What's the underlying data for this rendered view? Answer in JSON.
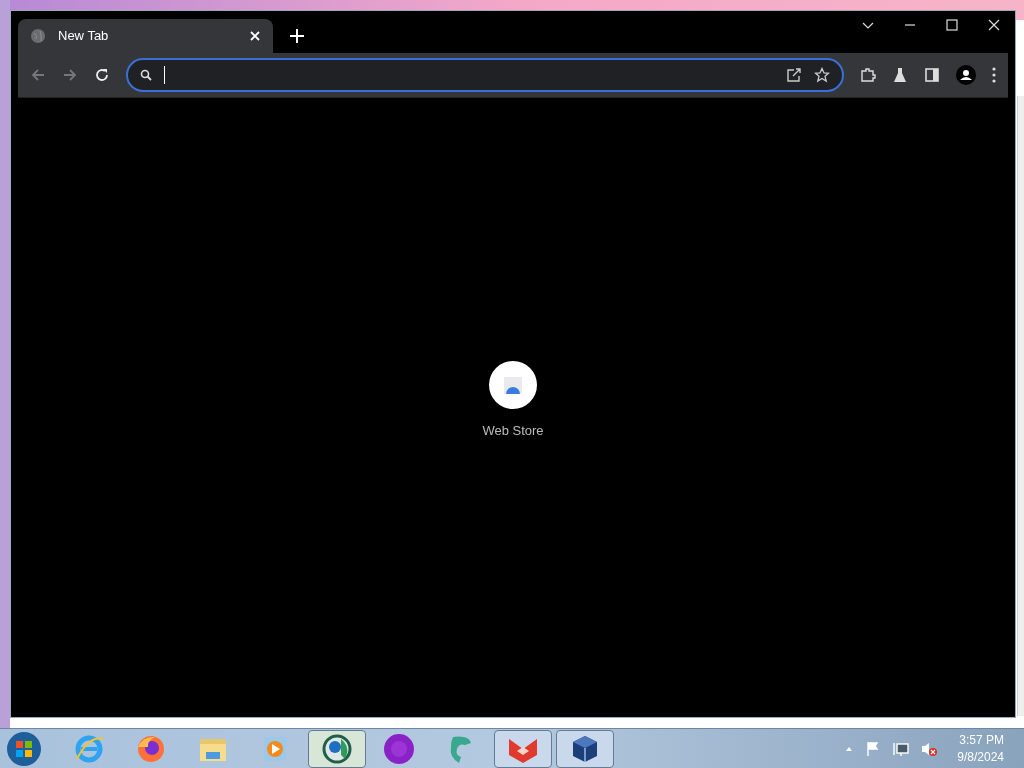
{
  "browser": {
    "tabs": [
      {
        "title": "New Tab",
        "selected": true
      }
    ],
    "shortcuts": [
      {
        "label": "Web Store"
      }
    ]
  },
  "taskbar": {
    "apps": [
      {
        "kind": "ie",
        "running": false,
        "selected": false
      },
      {
        "kind": "firefox",
        "running": false,
        "selected": false
      },
      {
        "kind": "folder",
        "running": false,
        "selected": false
      },
      {
        "kind": "media",
        "running": false,
        "selected": false
      },
      {
        "kind": "chrome",
        "running": true,
        "selected": true
      },
      {
        "kind": "orb",
        "running": false,
        "selected": false
      },
      {
        "kind": "dragon",
        "running": false,
        "selected": false
      },
      {
        "kind": "fox",
        "running": true,
        "selected": false
      },
      {
        "kind": "cube",
        "running": true,
        "selected": false
      }
    ],
    "clock": {
      "time": "3:57 PM",
      "date": "9/8/2024"
    }
  }
}
